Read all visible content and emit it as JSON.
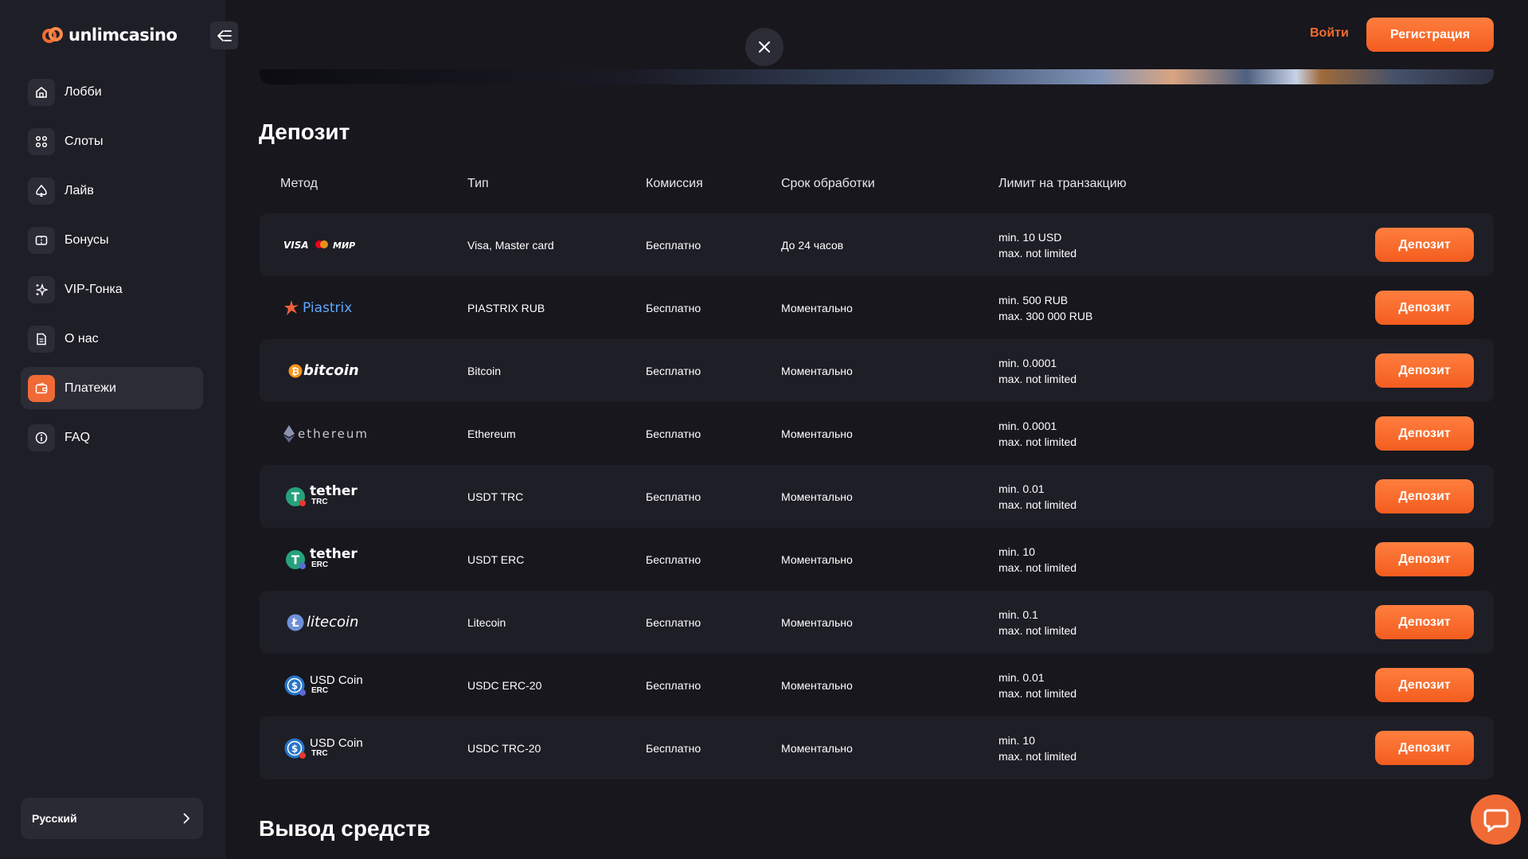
{
  "brand": {
    "name": "unlimcasino",
    "accent": "#f06a35"
  },
  "sidebar": {
    "items": [
      {
        "label": "Лобби",
        "icon": "home-icon",
        "active": false
      },
      {
        "label": "Слоты",
        "icon": "grid-icon",
        "active": false
      },
      {
        "label": "Лайв",
        "icon": "spade-icon",
        "active": false
      },
      {
        "label": "Бонусы",
        "icon": "ticket-icon",
        "active": false
      },
      {
        "label": "VIP-Гонка",
        "icon": "sparkles-icon",
        "active": false
      },
      {
        "label": "О нас",
        "icon": "document-icon",
        "active": false
      },
      {
        "label": "Платежи",
        "icon": "wallet-icon",
        "active": true
      },
      {
        "label": "FAQ",
        "icon": "info-icon",
        "active": false
      }
    ],
    "language": "Русский"
  },
  "header": {
    "login_label": "Войти",
    "register_label": "Регистрация"
  },
  "deposit": {
    "title": "Депозит",
    "columns": [
      "Метод",
      "Тип",
      "Комиссия",
      "Срок обработки",
      "Лимит на транзакцию"
    ],
    "button_label": "Депозит",
    "rows": [
      {
        "method_logo": "visa-mastercard-mir-logo",
        "type": "Visa, Master card",
        "fee": "Бесплатно",
        "time": "До 24 часов",
        "min": "min. 10 USD",
        "max": "max. not limited"
      },
      {
        "method_logo": "piastrix-logo",
        "logo_text": "Piastrix",
        "type": "PIASTRIX RUB",
        "fee": "Бесплатно",
        "time": "Моментально",
        "min": "min. 500 RUB",
        "max": "max. 300 000 RUB"
      },
      {
        "method_logo": "bitcoin-logo",
        "logo_text": "bitcoin",
        "type": "Bitcoin",
        "fee": "Бесплатно",
        "time": "Моментально",
        "min": "min. 0.0001",
        "max": "max. not limited"
      },
      {
        "method_logo": "ethereum-logo",
        "logo_text": "ethereum",
        "type": "Ethereum",
        "fee": "Бесплатно",
        "time": "Моментально",
        "min": "min. 0.0001",
        "max": "max. not limited"
      },
      {
        "method_logo": "tether-trc-logo",
        "logo_text": "tether",
        "logo_sub": "TRC",
        "type": "USDT TRC",
        "fee": "Бесплатно",
        "time": "Моментально",
        "min": "min. 0.01",
        "max": "max. not limited"
      },
      {
        "method_logo": "tether-erc-logo",
        "logo_text": "tether",
        "logo_sub": "ERC",
        "type": "USDT ERC",
        "fee": "Бесплатно",
        "time": "Моментально",
        "min": "min. 10",
        "max": "max. not limited"
      },
      {
        "method_logo": "litecoin-logo",
        "logo_text": "litecoin",
        "type": "Litecoin",
        "fee": "Бесплатно",
        "time": "Моментально",
        "min": "min. 0.1",
        "max": "max. not limited"
      },
      {
        "method_logo": "usdcoin-erc-logo",
        "logo_text": "USD Coin",
        "logo_sub": "ERC",
        "type": "USDC ERC-20",
        "fee": "Бесплатно",
        "time": "Моментально",
        "min": "min. 0.01",
        "max": "max. not limited"
      },
      {
        "method_logo": "usdcoin-trc-logo",
        "logo_text": "USD Coin",
        "logo_sub": "TRC",
        "type": "USDC TRC-20",
        "fee": "Бесплатно",
        "time": "Моментально",
        "min": "min. 10",
        "max": "max. not limited"
      }
    ]
  },
  "withdraw": {
    "title": "Вывод средств"
  }
}
